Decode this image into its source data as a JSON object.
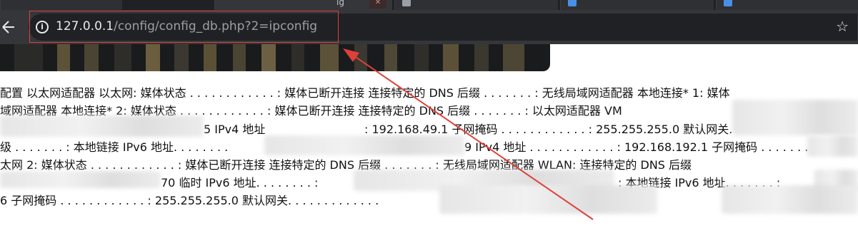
{
  "browser": {
    "tabs": [
      {
        "title": ""
      },
      {
        "title": "ig"
      },
      {
        "title": ""
      },
      {
        "title": ""
      },
      {
        "title": ""
      }
    ],
    "close_label": "✕",
    "url_host": "127.0.0.1",
    "url_path": "/config/config_db.php?2=ipconfig"
  },
  "content": {
    "lines": [
      "配置 以太网适配器 以太网: 媒体状态 . . . . . . . . . . . . : 媒体已断开连接 连接特定的 DNS 后缀 . . . . . . . : 无线局域网适配器 本地连接* 1: 媒体",
      "域网适配器 本地连接* 2: 媒体状态 . . . . . . . . . . . . : 媒体已断开连接 连接特定的 DNS 后缀 . . . . . . . : 以太网适配器 VM",
      "5 IPv4 地址",
      ": 192.168.49.1 子网掩码 . . . . . . . . . . . . : 255.255.255.0 默认网关.",
      "级 . . . . . . . : 本地链接 IPv6 地址. . . . . . . .",
      "9 IPv4 地址 . . . . . . . . . . . . : 192.168.192.1 子网掩码 . . . . . . . . .",
      "太网 2: 媒体状态 . . . . . . . . . . . . : 媒体已断开连接 连接特定的 DNS 后缀 . . . . . . . : 无线局域网适配器 WLAN: 连接特定的 DNS 后缀",
      "70 临时 IPv6 地址. . . . . . . . :",
      ": 本地链接 IPv6 地址. . . . . . . :",
      "6 子网掩码 . . . . . . . . . . . . : 255.255.255.0 默认网关. . . . . . . . . . . . ."
    ]
  },
  "colors": {
    "annotation": "#e0403a",
    "omnibox_bg": "#202124",
    "toolbar_bg": "#35363a"
  },
  "icons": [
    "back-arrow-icon",
    "info-icon",
    "star-icon",
    "tab-favicon-icon"
  ]
}
